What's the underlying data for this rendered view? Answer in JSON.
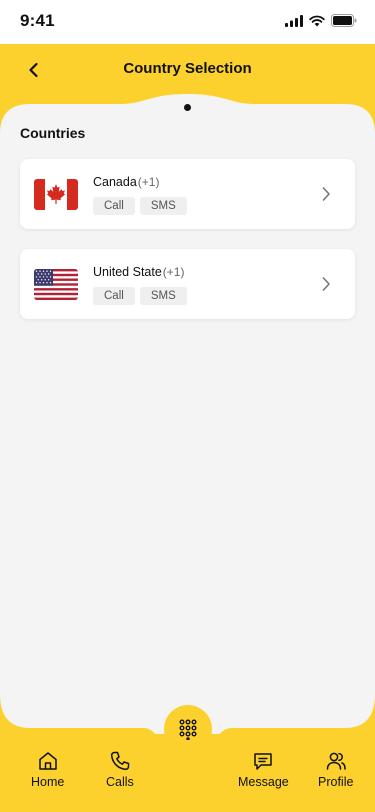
{
  "status_bar": {
    "time": "9:41"
  },
  "header": {
    "title": "Country Selection"
  },
  "section": {
    "title": "Countries"
  },
  "countries": [
    {
      "name": "Canada",
      "dial_code": "(+1)",
      "flag_icon": "canada-flag-icon",
      "tags": [
        "Call",
        "SMS"
      ]
    },
    {
      "name": "United State",
      "dial_code": "(+1)",
      "flag_icon": "usa-flag-icon",
      "tags": [
        "Call",
        "SMS"
      ]
    }
  ],
  "tab_bar": {
    "items": [
      {
        "label": "Home",
        "icon": "home-icon"
      },
      {
        "label": "Calls",
        "icon": "phone-icon"
      },
      {
        "label": "Message",
        "icon": "message-icon"
      },
      {
        "label": "Profile",
        "icon": "users-icon"
      }
    ],
    "center_button_icon": "dialpad-icon"
  },
  "colors": {
    "accent": "#FCD12E",
    "background": "#F4F4F4",
    "card": "#FFFFFF"
  }
}
